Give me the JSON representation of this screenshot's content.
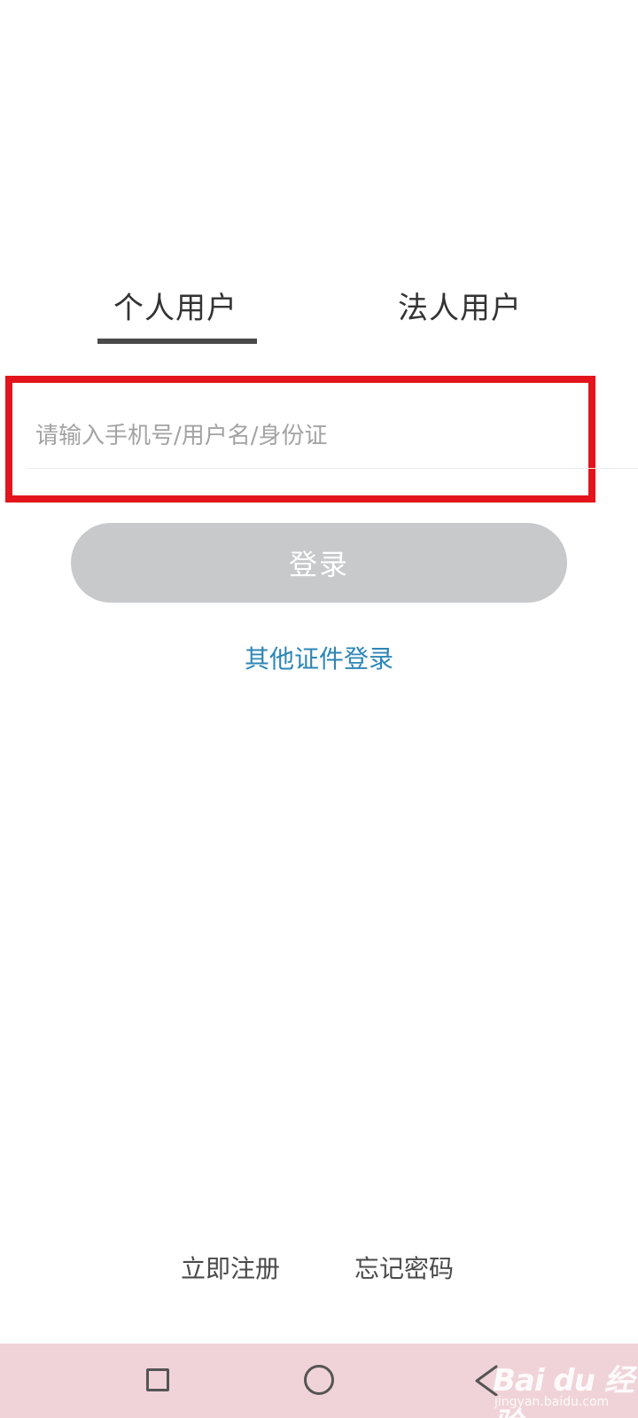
{
  "tabs": {
    "personal": "个人用户",
    "legal": "法人用户"
  },
  "login_form": {
    "account_placeholder": "请输入手机号/用户名/身份证",
    "account_value": "",
    "login_button": "登录",
    "other_id_login": "其他证件登录"
  },
  "footer_links": {
    "register": "立即注册",
    "forgot_password": "忘记密码"
  },
  "nav_bar": {
    "icons": [
      "recent-apps-icon",
      "home-icon",
      "back-icon"
    ]
  },
  "watermark": {
    "logo_text": "Bai du 经验",
    "sub_text": "jingyan.baidu.com"
  },
  "colors": {
    "highlight": "#e3141c",
    "link": "#2c86b8",
    "button_disabled": "#c8c9cb",
    "nav_bar": "#f0d3d8"
  }
}
